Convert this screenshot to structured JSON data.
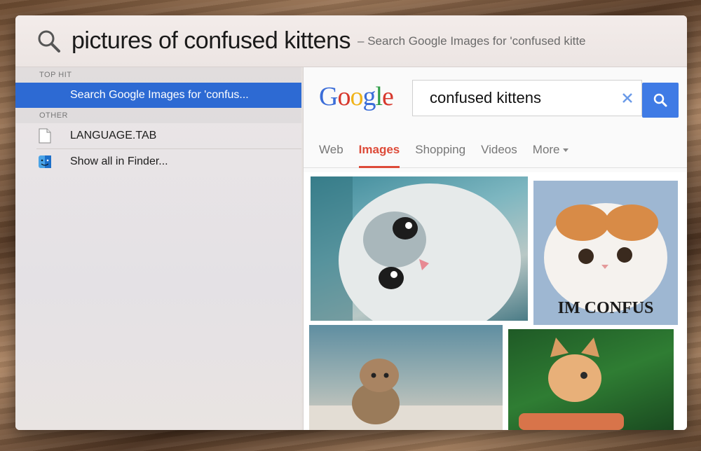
{
  "spotlight": {
    "query": "pictures of confused kittens",
    "query_hint": "– Search Google Images for 'confused kitte"
  },
  "sections": {
    "top_hit_label": "TOP HIT",
    "other_label": "OTHER"
  },
  "results": {
    "top_hit": "Search Google Images for 'confus...",
    "other": [
      {
        "label": "LANGUAGE.TAB",
        "icon": "document-icon"
      },
      {
        "label": "Show all in Finder...",
        "icon": "finder-icon"
      }
    ]
  },
  "google": {
    "logo_letters": [
      "G",
      "o",
      "o",
      "g",
      "l",
      "e"
    ],
    "search_value": "confused kittens",
    "tabs": [
      "Web",
      "Images",
      "Shopping",
      "Videos",
      "More"
    ],
    "active_tab": "Images",
    "brand_blue": "#3f7be5",
    "active_red": "#dd4b39"
  },
  "images": {
    "caption_4": "IM CONFUS"
  },
  "colors": {
    "selection": "#2d6ad3"
  }
}
